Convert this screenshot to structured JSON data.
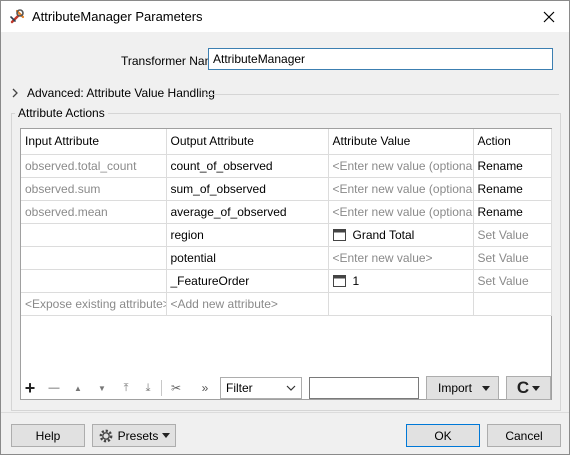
{
  "window": {
    "title": "AttributeManager Parameters",
    "close_glyph": "✕",
    "app_icon": "fme-wrench-icon"
  },
  "transformer": {
    "label": "Transformer Name:",
    "value": "AttributeManager"
  },
  "advanced": {
    "label": "Advanced: Attribute Value Handling",
    "expanded": false
  },
  "actions_group": {
    "title": "Attribute Actions"
  },
  "table": {
    "headers": [
      "Input Attribute",
      "Output Attribute",
      "Attribute Value",
      "Action"
    ],
    "rows": [
      {
        "input": "observed.total_count",
        "output": "count_of_observed",
        "value": "<Enter new value (optional)>",
        "value_icon": false,
        "action": "Rename"
      },
      {
        "input": "observed.sum",
        "output": "sum_of_observed",
        "value": "<Enter new value (optional)>",
        "value_icon": false,
        "action": "Rename"
      },
      {
        "input": "observed.mean",
        "output": "average_of_observed",
        "value": "<Enter new value (optional)>",
        "value_icon": false,
        "action": "Rename"
      },
      {
        "input": "",
        "output": "region",
        "value": "Grand Total",
        "value_icon": true,
        "action": "Set Value"
      },
      {
        "input": "",
        "output": "potential",
        "value": "<Enter new value>",
        "value_icon": false,
        "action": "Set Value"
      },
      {
        "input": "",
        "output": "_FeatureOrder",
        "value": "1",
        "value_icon": true,
        "action": "Set Value"
      },
      {
        "input": "<Expose existing attribute>",
        "output": "<Add new attribute>",
        "value": "",
        "value_icon": false,
        "action": ""
      }
    ]
  },
  "toolbar": {
    "add_glyph": "+",
    "remove_glyph": "—",
    "move_up_glyph": "▲",
    "move_down_glyph": "▼",
    "move_top_glyph": "⤒",
    "move_bottom_glyph": "⤓",
    "cut_glyph": "✂",
    "more_glyph": "»",
    "filter_label": "Filter",
    "filter_value": "",
    "import_label": "Import",
    "refresh_glyph": "C"
  },
  "footer": {
    "help": "Help",
    "presets": "Presets",
    "ok": "OK",
    "cancel": "Cancel"
  }
}
